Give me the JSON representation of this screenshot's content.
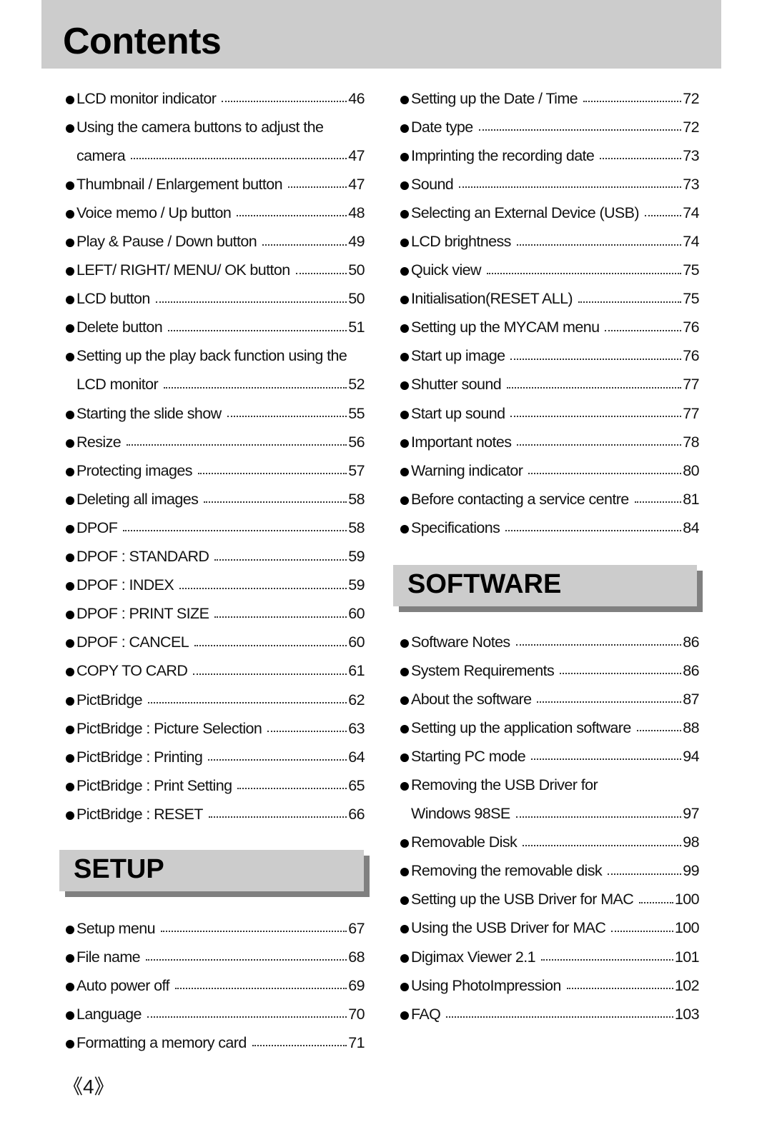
{
  "title": "Contents",
  "left_items": [
    {
      "label": "LCD monitor indicator",
      "page": "46"
    },
    {
      "label": "Using the camera buttons to adjust the",
      "page": ""
    },
    {
      "label": "camera",
      "page": "47",
      "continuation": true
    },
    {
      "label": "Thumbnail / Enlargement button",
      "page": "47"
    },
    {
      "label": "Voice memo / Up button",
      "page": "48"
    },
    {
      "label": "Play & Pause / Down button",
      "page": "49"
    },
    {
      "label": "LEFT/ RIGHT/ MENU/ OK button",
      "page": "50"
    },
    {
      "label": "LCD button",
      "page": "50"
    },
    {
      "label": "Delete button",
      "page": "51"
    },
    {
      "label": "Setting up the play back function using the",
      "page": ""
    },
    {
      "label": "LCD monitor",
      "page": "52",
      "continuation": true
    },
    {
      "label": "Starting the slide show",
      "page": "55"
    },
    {
      "label": "Resize",
      "page": "56"
    },
    {
      "label": "Protecting images",
      "page": "57"
    },
    {
      "label": "Deleting all images",
      "page": "58"
    },
    {
      "label": "DPOF",
      "page": "58"
    },
    {
      "label": "DPOF : STANDARD",
      "page": "59"
    },
    {
      "label": "DPOF : INDEX",
      "page": "59"
    },
    {
      "label": "DPOF : PRINT SIZE",
      "page": "60"
    },
    {
      "label": "DPOF : CANCEL",
      "page": "60"
    },
    {
      "label": "COPY TO CARD",
      "page": "61"
    },
    {
      "label": "PictBridge",
      "page": "62"
    },
    {
      "label": "PictBridge : Picture Selection",
      "page": "63"
    },
    {
      "label": "PictBridge : Printing",
      "page": "64"
    },
    {
      "label": "PictBridge : Print Setting",
      "page": "65"
    },
    {
      "label": "PictBridge : RESET",
      "page": "66"
    }
  ],
  "setup": {
    "heading": "SETUP",
    "items": [
      {
        "label": "Setup menu",
        "page": "67"
      },
      {
        "label": "File name",
        "page": "68"
      },
      {
        "label": "Auto power off",
        "page": "69"
      },
      {
        "label": "Language",
        "page": "70"
      },
      {
        "label": "Formatting a memory card",
        "page": "71"
      }
    ]
  },
  "right_items": [
    {
      "label": "Setting up the Date / Time",
      "page": "72"
    },
    {
      "label": "Date type",
      "page": "72"
    },
    {
      "label": "Imprinting the recording date",
      "page": "73"
    },
    {
      "label": "Sound",
      "page": "73"
    },
    {
      "label": "Selecting an External Device (USB)",
      "page": "74"
    },
    {
      "label": "LCD brightness",
      "page": "74"
    },
    {
      "label": "Quick view",
      "page": "75"
    },
    {
      "label": "Initialisation(RESET ALL)",
      "page": "75"
    },
    {
      "label": "Setting up the MYCAM menu",
      "page": "76"
    },
    {
      "label": "Start up image",
      "page": "76"
    },
    {
      "label": "Shutter sound",
      "page": "77"
    },
    {
      "label": "Start up sound",
      "page": "77"
    },
    {
      "label": "Important notes",
      "page": "78"
    },
    {
      "label": "Warning indicator",
      "page": "80"
    },
    {
      "label": "Before contacting a service centre",
      "page": "81"
    },
    {
      "label": "Specifications",
      "page": "84"
    }
  ],
  "software": {
    "heading": "SOFTWARE",
    "items": [
      {
        "label": "Software Notes",
        "page": "86"
      },
      {
        "label": "System Requirements",
        "page": "86"
      },
      {
        "label": "About the software",
        "page": "87"
      },
      {
        "label": "Setting up the application software",
        "page": "88"
      },
      {
        "label": "Starting PC mode",
        "page": "94"
      },
      {
        "label": "Removing the USB Driver for",
        "page": ""
      },
      {
        "label": "Windows 98SE",
        "page": "97",
        "continuation": true
      },
      {
        "label": "Removable Disk",
        "page": "98"
      },
      {
        "label": "Removing the removable disk",
        "page": "99"
      },
      {
        "label": "Setting up the USB Driver for MAC",
        "page": "100"
      },
      {
        "label": "Using the USB Driver for MAC",
        "page": "100"
      },
      {
        "label": "Digimax Viewer 2.1",
        "page": "101"
      },
      {
        "label": "Using PhotoImpression",
        "page": "102"
      },
      {
        "label": "FAQ",
        "page": "103"
      }
    ]
  },
  "footer": {
    "page_number": "《4》"
  }
}
